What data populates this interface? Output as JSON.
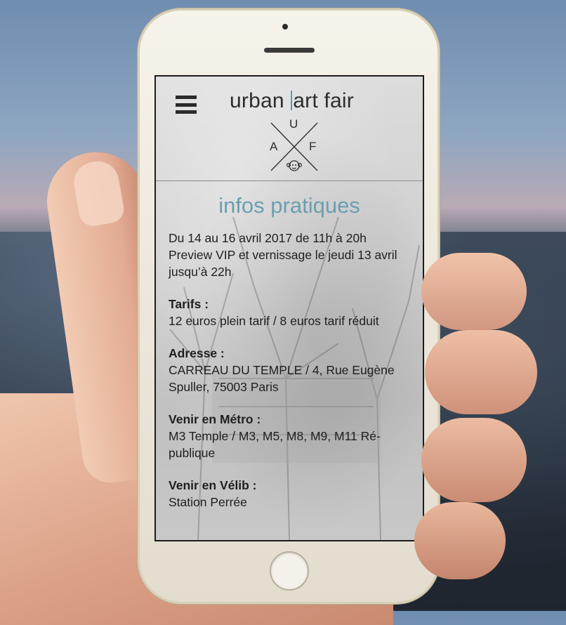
{
  "app": {
    "brand_left": "urban",
    "brand_right": "art fair",
    "logo_letters": {
      "top": "U",
      "left": "A",
      "right": "F"
    },
    "accent_color": "#6b9fb0"
  },
  "page": {
    "title": "infos pratiques",
    "intro": "Du 14 au 16 avril 2017 de 11h à 20h Preview VIP et vernissage le jeudi 13 avril jusqu’à 22h",
    "sections": [
      {
        "heading": "Tarifs :",
        "text": "12 euros plein tarif / 8 euros tarif réduit"
      },
      {
        "heading": "Adresse :",
        "text": "CARREAU DU TEMPLE / 4, Rue Eugène Spuller, 75003 Paris"
      },
      {
        "heading": "Venir en Métro :",
        "text": "M3 Temple / M3, M5, M8, M9, M11 Ré-publique"
      },
      {
        "heading": "Venir en Vélib :",
        "text": "Station Perrée"
      }
    ]
  },
  "icons": {
    "menu": "hamburger-icon",
    "mascot": "monkey-icon",
    "home": "home-button-icon"
  }
}
